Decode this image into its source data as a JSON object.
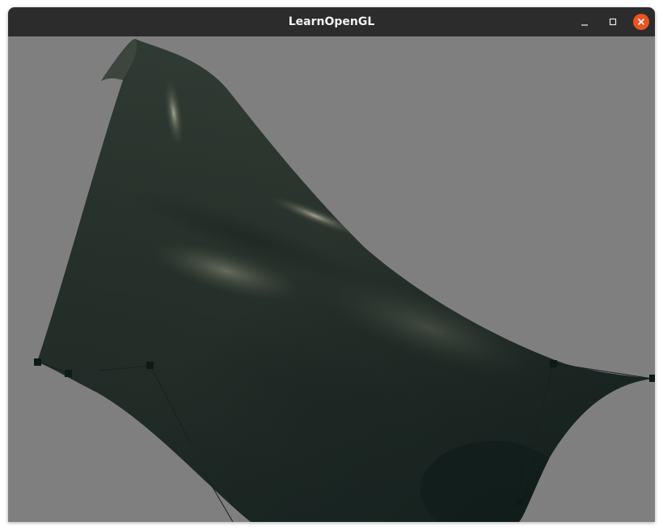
{
  "window": {
    "title": "LearnOpenGL"
  },
  "titlebar": {
    "buttons": [
      {
        "name": "minimize",
        "icon": "minimize-icon"
      },
      {
        "name": "maximize",
        "icon": "maximize-icon"
      },
      {
        "name": "close",
        "icon": "close-icon"
      }
    ]
  },
  "scene": {
    "clear_color": "#7f7f7f",
    "surface_color": "#2f3a33",
    "control_point_color": "#0e1a17",
    "close_button_color": "#e95420"
  }
}
